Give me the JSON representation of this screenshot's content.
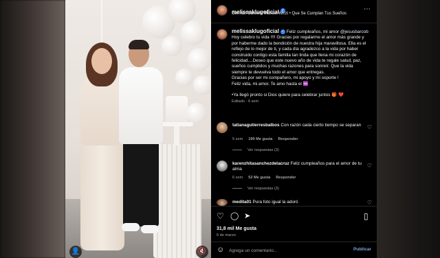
{
  "post": {
    "username": "melissaklugoficial",
    "audio": "Germán Barceló, Manuel Wirzt • Que Se Cumplan Tus Sueños",
    "caption": {
      "username": "melissaklugoficial",
      "intro": "Feliz cumpleaños, mi amor ",
      "mention": "@jesusbarcob",
      "body": "Hoy celebro tu vida !!!! Gracias por regalarme el amor más grande y por haberme dado la bendición de nuestra hija maravillosa. Ella es el reflejo de lo mejor de ti, y cada día agradezco a la vida por haber construido contigo esta familia tan linda que llena mi corazón de felicidad....Deseo que este nuevo año de vida te regale salud, paz, sueños cumplidos y muchas razones para sonreír. Que la vida siempre te devuelva todo el amor que entregas.\nGracias por ser mi compañero, mi apoyo y mi soporte !\nFeliz vida, mi amor. Te amo hasta el ♾️\n\n•Ya llegó pronto si Dios quiere para celebrar juntos 🎁 ❤️",
      "meta": "Editado · 6 sem"
    },
    "comments": [
      {
        "username": "tatianagutierresbalbos",
        "text": "Con razón cada cierto tiempo se separan",
        "time": "5 sem",
        "likes": "190 Me gusta",
        "reply": "Responder",
        "replies": "Ver respuestas (3)"
      },
      {
        "username": "karenzhitasanchezdelacruz",
        "text": "Feliz cumpleaños para el amor de tu alma",
        "time": "6 sem",
        "likes": "52 Me gusta",
        "reply": "Responder",
        "replies": "Ver respuestas (3)"
      },
      {
        "username": "medita01",
        "text": "Pura foto igual la adoró"
      }
    ],
    "likes": "31,8 mil Me gusta",
    "date": "6 de marzo",
    "composer": {
      "placeholder": "Agrega un comentario...",
      "publish": "Publicar"
    }
  },
  "icons": {
    "more": "⋯",
    "verified": "✓",
    "heart_small": "♡",
    "like": "♡",
    "comment": "◯",
    "share": "➤",
    "save": "▯",
    "emoji": "☺",
    "photo_tags": "👤",
    "audio": "🔇"
  },
  "colors": {
    "panel_bg": "#000000",
    "verified": "#3b82f6",
    "mention": "#e0f1ff",
    "muted": "#a8a8a8",
    "publish": "#7aa7d8"
  }
}
